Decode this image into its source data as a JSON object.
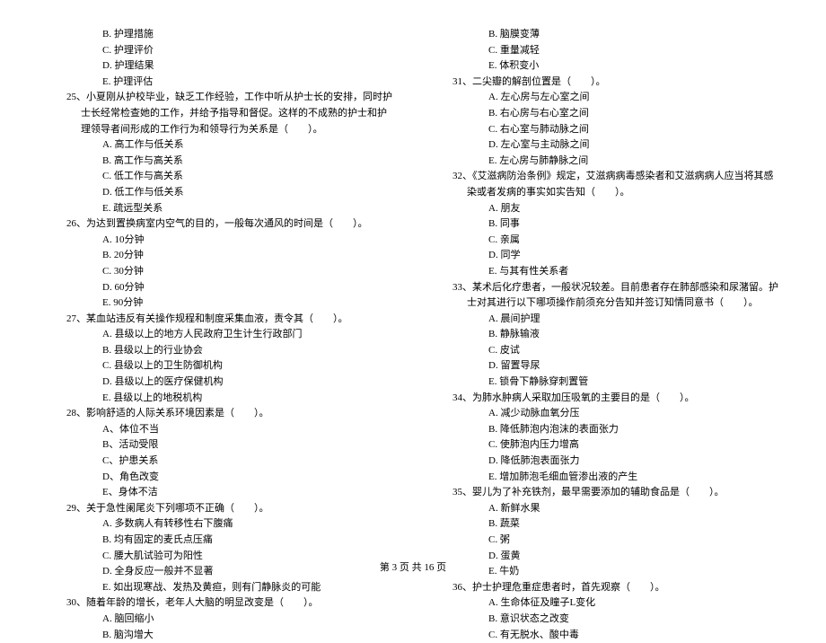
{
  "left_column": {
    "pre_options": [
      "B. 护理措施",
      "C. 护理评价",
      "D. 护理结果",
      "E. 护理评估"
    ],
    "q25": {
      "text": "25、小夏刚从护校毕业，缺乏工作经验，工作中听从护士长的安排，同时护士长经常检查她的工作，并给予指导和督促。这样的不成熟的护士和护理领导者间形成的工作行为和领导行为关系是（　　）。",
      "options": [
        "A. 高工作与低关系",
        "B. 高工作与高关系",
        "C. 低工作与高关系",
        "D. 低工作与低关系",
        "E. 疏远型关系"
      ]
    },
    "q26": {
      "text": "26、为达到置换病室内空气的目的，一般每次通风的时间是（　　）。",
      "options": [
        "A. 10分钟",
        "B. 20分钟",
        "C. 30分钟",
        "D. 60分钟",
        "E. 90分钟"
      ]
    },
    "q27": {
      "text": "27、某血站违反有关操作规程和制度采集血液，责令其（　　）。",
      "options": [
        "A. 县级以上的地方人民政府卫生计生行政部门",
        "B. 县级以上的行业协会",
        "C. 县级以上的卫生防御机构",
        "D. 县级以上的医疗保健机构",
        "E. 县级以上的地税机构"
      ]
    },
    "q28": {
      "text": "28、影响舒适的人际关系环境因素是（　　）。",
      "options": [
        "A、体位不当",
        "B、活动受限",
        "C、护患关系",
        "D、角色改变",
        "E、身体不洁"
      ]
    },
    "q29": {
      "text": "29、关于急性阑尾炎下列哪项不正确（　　）。",
      "options": [
        "A. 多数病人有转移性右下腹痛",
        "B. 均有固定的麦氏点压痛",
        "C. 腰大肌试验可为阳性",
        "D. 全身反应一般并不显著",
        "E. 如出现寒战、发热及黄疸，则有门静脉炎的可能"
      ]
    },
    "q30": {
      "text": "30、随着年龄的增长，老年人大脑的明显改变是（　　）。",
      "options": [
        "A. 脑回缩小",
        "B. 脑沟增大"
      ]
    }
  },
  "right_column": {
    "pre_options": [
      "B. 脑膜变薄",
      "C. 重量减轻",
      "E. 体积变小"
    ],
    "q31": {
      "text": "31、二尖瓣的解剖位置是（　　）。",
      "options": [
        "A. 左心房与左心室之间",
        "B. 右心房与右心室之间",
        "C. 右心室与肺动脉之间",
        "D. 左心室与主动脉之间",
        "E. 左心房与肺静脉之间"
      ]
    },
    "q32": {
      "text": "32、《艾滋病防治条例》规定，艾滋病病毒感染者和艾滋病病人应当将其感染或者发病的事实如实告知（　　）。",
      "options": [
        "A. 朋友",
        "B. 同事",
        "C. 亲属",
        "D. 同学",
        "E. 与其有性关系者"
      ]
    },
    "q33": {
      "text": "33、某术后化疗患者，一般状况较差。目前患者存在肺部感染和尿潴留。护士对其进行以下哪项操作前须充分告知并签订知情同意书（　　）。",
      "options": [
        "A. 晨间护理",
        "B. 静脉输液",
        "C. 皮试",
        "D. 留置导尿",
        "E. 锁骨下静脉穿刺置管"
      ]
    },
    "q34": {
      "text": "34、为肺水肿病人采取加压吸氧的主要目的是（　　）。",
      "options": [
        "A. 减少动脉血氧分压",
        "B. 降低肺泡内泡沫的表面张力",
        "C. 使肺泡内压力增高",
        "D. 降低肺泡表面张力",
        "E. 增加肺泡毛细血管渗出液的产生"
      ]
    },
    "q35": {
      "text": "35、婴儿为了补充铁剂，最早需要添加的辅助食品是（　　）。",
      "options": [
        "A. 新鲜水果",
        "B. 蔬菜",
        "C. 粥",
        "D. 蛋黄",
        "E. 牛奶"
      ]
    },
    "q36": {
      "text": "36、护士护理危重症患者时，首先观察（　　）。",
      "options": [
        "A. 生命体征及瞳子L变化",
        "B. 意识状态之改变",
        "C. 有无脱水、酸中毒"
      ]
    }
  },
  "footer": "第 3 页 共 16 页"
}
